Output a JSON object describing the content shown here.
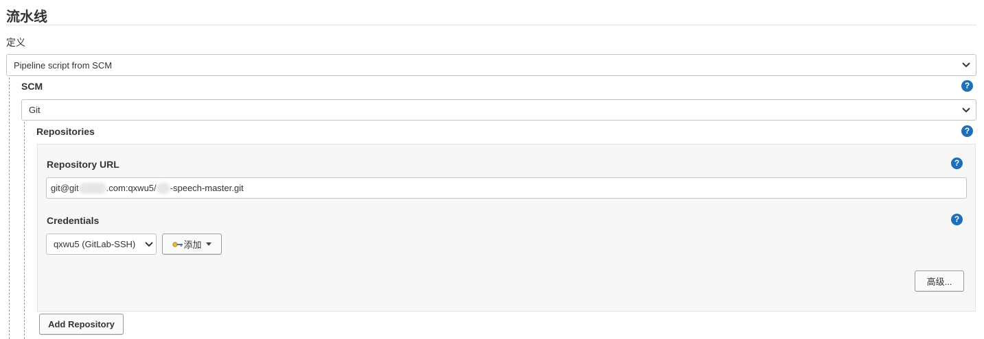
{
  "page_title": "流水线",
  "definition": {
    "label": "定义",
    "selected": "Pipeline script from SCM"
  },
  "scm": {
    "label": "SCM",
    "selected": "Git"
  },
  "repositories": {
    "label": "Repositories",
    "repo_url": {
      "label": "Repository URL",
      "value_part1": "git@git",
      "value_part2": ".com:qxwu5/",
      "value_part3": "-speech-master.git"
    },
    "credentials": {
      "label": "Credentials",
      "selected": "qxwu5 (GitLab-SSH)",
      "add_button": "添加"
    },
    "advanced_button": "高级...",
    "add_repository_button": "Add Repository"
  },
  "help_icon_text": "?",
  "colors": {
    "help_icon": "#1d6fb7",
    "border": "#c3c3c3",
    "panel_bg": "#f7f7f7"
  }
}
